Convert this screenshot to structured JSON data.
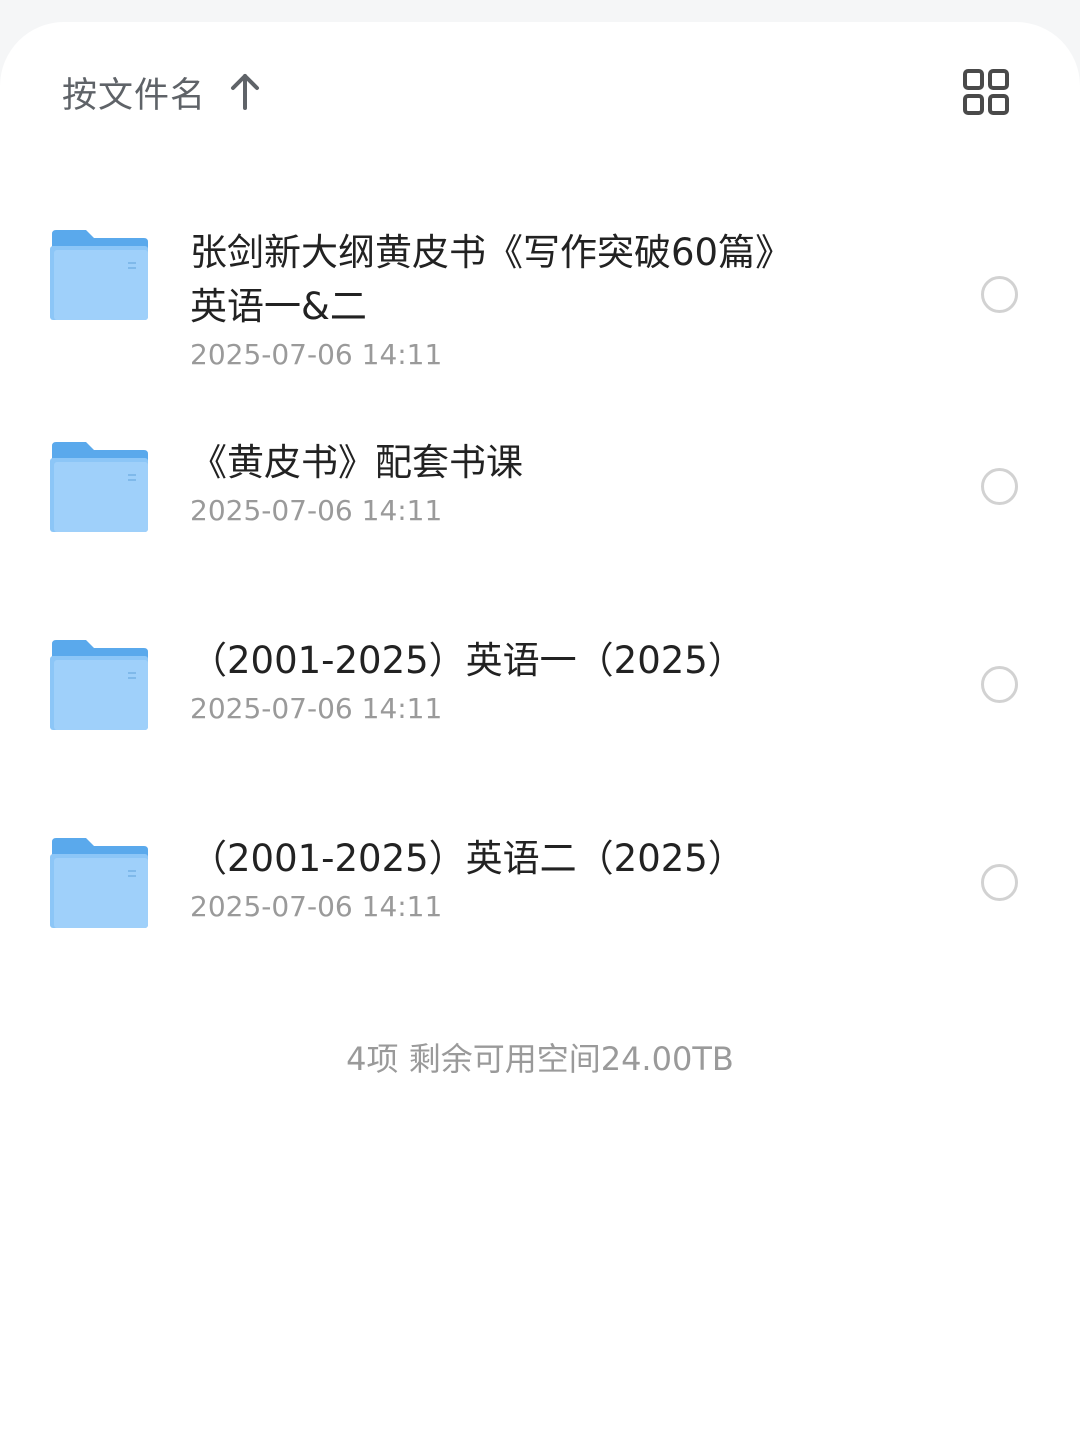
{
  "toolbar": {
    "sort_label": "按文件名",
    "sort_icon": "arrow-up-icon",
    "view_toggle_icon": "grid-view-icon"
  },
  "files": [
    {
      "name_line1": "张剑新大纲黄皮书《写作突破60篇》",
      "name_line2": "英语一&二",
      "date": "2025-07-06 14:11",
      "icon": "folder-icon"
    },
    {
      "name_line1": "《黄皮书》配套书课",
      "name_line2": "",
      "date": "2025-07-06 14:11",
      "icon": "folder-icon"
    },
    {
      "name_line1": "（2001-2025）英语一（2025）",
      "name_line2": "",
      "date": "2025-07-06 14:11",
      "icon": "folder-icon"
    },
    {
      "name_line1": "（2001-2025）英语二（2025）",
      "name_line2": "",
      "date": "2025-07-06 14:11",
      "icon": "folder-icon"
    }
  ],
  "footer": {
    "summary": "4项 剩余可用空间24.00TB"
  },
  "colors": {
    "folder_top": "#5aa9ec",
    "folder_body": "#8cc6f7",
    "text_primary": "#222222",
    "text_secondary": "#9a9a9a"
  }
}
